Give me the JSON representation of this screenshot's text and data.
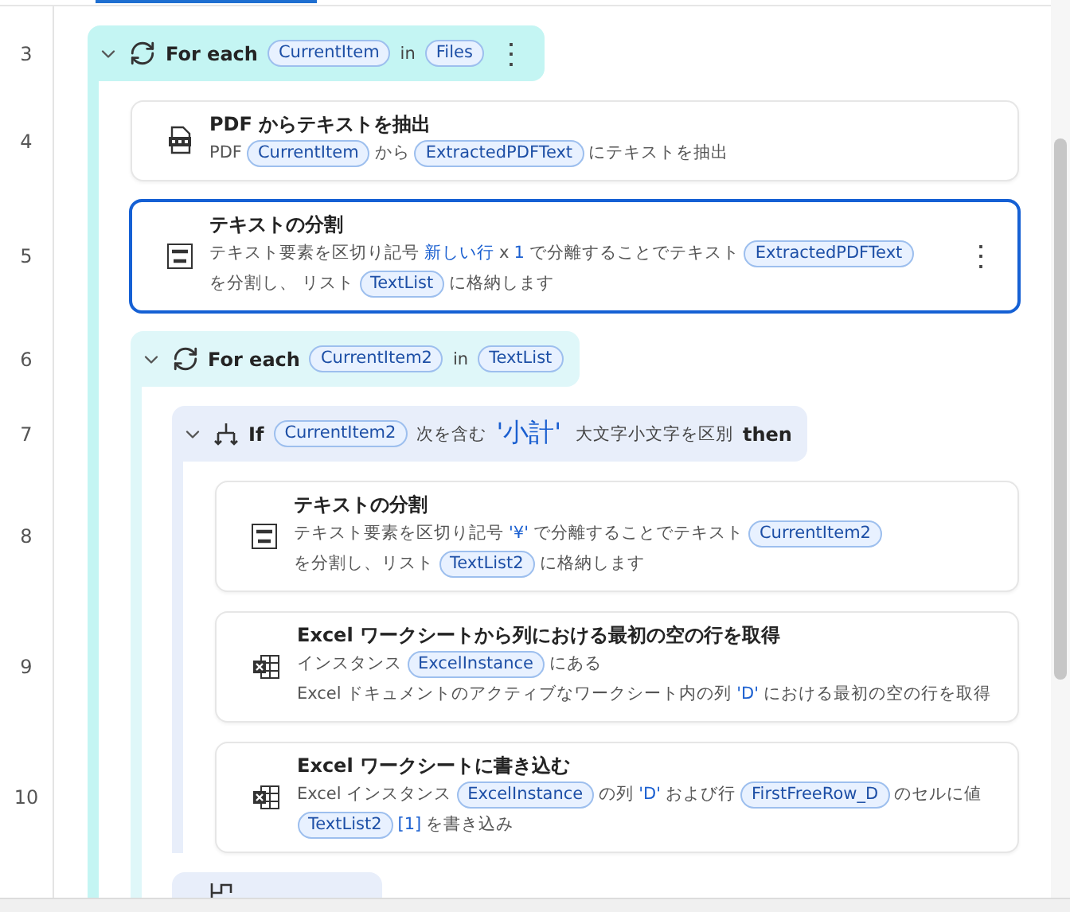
{
  "steps": [
    {
      "kind": "loop",
      "line": "3",
      "expanded": true,
      "menu": "⋮",
      "segments": [
        {
          "kind": "keyword",
          "text": "For each"
        },
        {
          "kind": "var",
          "text": "CurrentItem"
        },
        {
          "kind": "text",
          "text": "in"
        },
        {
          "kind": "var",
          "text": "Files"
        }
      ],
      "children": [
        {
          "kind": "pdf",
          "line": "4",
          "selected": false,
          "title": "PDF からテキストを抽出",
          "segments": [
            {
              "kind": "text",
              "text": "PDF"
            },
            {
              "kind": "var",
              "text": "CurrentItem"
            },
            {
              "kind": "text",
              "text": "から"
            },
            {
              "kind": "var",
              "text": "ExtractedPDFText"
            },
            {
              "kind": "text",
              "text": "にテキストを抽出"
            }
          ]
        },
        {
          "kind": "split",
          "line": "5",
          "selected": true,
          "menu": "⋮",
          "title": "テキストの分割",
          "segments": [
            {
              "kind": "text",
              "text": "テキスト要素を区切り記号"
            },
            {
              "kind": "literal",
              "text": "新しい行"
            },
            {
              "kind": "text",
              "text": "x"
            },
            {
              "kind": "literal",
              "text": "1"
            },
            {
              "kind": "text",
              "text": "で分離することでテキスト"
            },
            {
              "kind": "var",
              "text": "ExtractedPDFText"
            },
            {
              "kind": "text",
              "text": "を分割し、"
            },
            {
              "kind": "text",
              "text": "リスト"
            },
            {
              "kind": "var",
              "text": "TextList"
            },
            {
              "kind": "text",
              "text": "に格納します"
            }
          ]
        },
        {
          "kind": "loop",
          "line": "6",
          "expanded": true,
          "segments": [
            {
              "kind": "keyword",
              "text": "For each"
            },
            {
              "kind": "var",
              "text": "CurrentItem2"
            },
            {
              "kind": "text",
              "text": "in"
            },
            {
              "kind": "var",
              "text": "TextList"
            }
          ],
          "children": [
            {
              "kind": "if",
              "line": "7",
              "expanded": true,
              "segments": [
                {
                  "kind": "keyword",
                  "text": "If"
                },
                {
                  "kind": "var",
                  "text": "CurrentItem2"
                },
                {
                  "kind": "text",
                  "text": "次を含む"
                },
                {
                  "kind": "literal",
                  "text": "'小計'"
                },
                {
                  "kind": "text",
                  "text": "大文字小文字を区別"
                },
                {
                  "kind": "keyword",
                  "text": "then"
                }
              ],
              "children": [
                {
                  "kind": "split",
                  "line": "8",
                  "selected": false,
                  "title": "テキストの分割",
                  "segments": [
                    {
                      "kind": "text",
                      "text": "テキスト要素を区切り記号"
                    },
                    {
                      "kind": "literal",
                      "text": "'¥'"
                    },
                    {
                      "kind": "text",
                      "text": "で分離することでテキスト"
                    },
                    {
                      "kind": "var",
                      "text": "CurrentItem2"
                    },
                    {
                      "kind": "text",
                      "text": "を分割し、リスト"
                    },
                    {
                      "kind": "var",
                      "text": "TextList2"
                    },
                    {
                      "kind": "text",
                      "text": "に格納します"
                    }
                  ]
                },
                {
                  "kind": "excel",
                  "line": "9",
                  "selected": false,
                  "title": "Excel ワークシートから列における最初の空の行を取得",
                  "segments": [
                    {
                      "kind": "text",
                      "text": "インスタンス"
                    },
                    {
                      "kind": "var",
                      "text": "ExcelInstance"
                    },
                    {
                      "kind": "text",
                      "text": "にある"
                    },
                    {
                      "kind": "text",
                      "text": "Excel ドキュメントのアクティブなワークシート内の列"
                    },
                    {
                      "kind": "literal",
                      "text": "'D'"
                    },
                    {
                      "kind": "text",
                      "text": "における最初の空の行を取得"
                    }
                  ]
                },
                {
                  "kind": "excel",
                  "line": "10",
                  "selected": false,
                  "title": "Excel ワークシートに書き込む",
                  "segments": [
                    {
                      "kind": "text",
                      "text": "Excel インスタンス"
                    },
                    {
                      "kind": "var",
                      "text": "ExcelInstance"
                    },
                    {
                      "kind": "text",
                      "text": "の列"
                    },
                    {
                      "kind": "literal",
                      "text": "'D'"
                    },
                    {
                      "kind": "text",
                      "text": "および行"
                    },
                    {
                      "kind": "var",
                      "text": "FirstFreeRow_D"
                    },
                    {
                      "kind": "text",
                      "text": "のセルに値"
                    },
                    {
                      "kind": "var",
                      "text": "TextList2"
                    },
                    {
                      "kind": "literal",
                      "text": "[1]"
                    },
                    {
                      "kind": "text",
                      "text": "を書き込み"
                    }
                  ]
                }
              ]
            },
            {
              "kind": "end"
            }
          ]
        }
      ]
    }
  ]
}
